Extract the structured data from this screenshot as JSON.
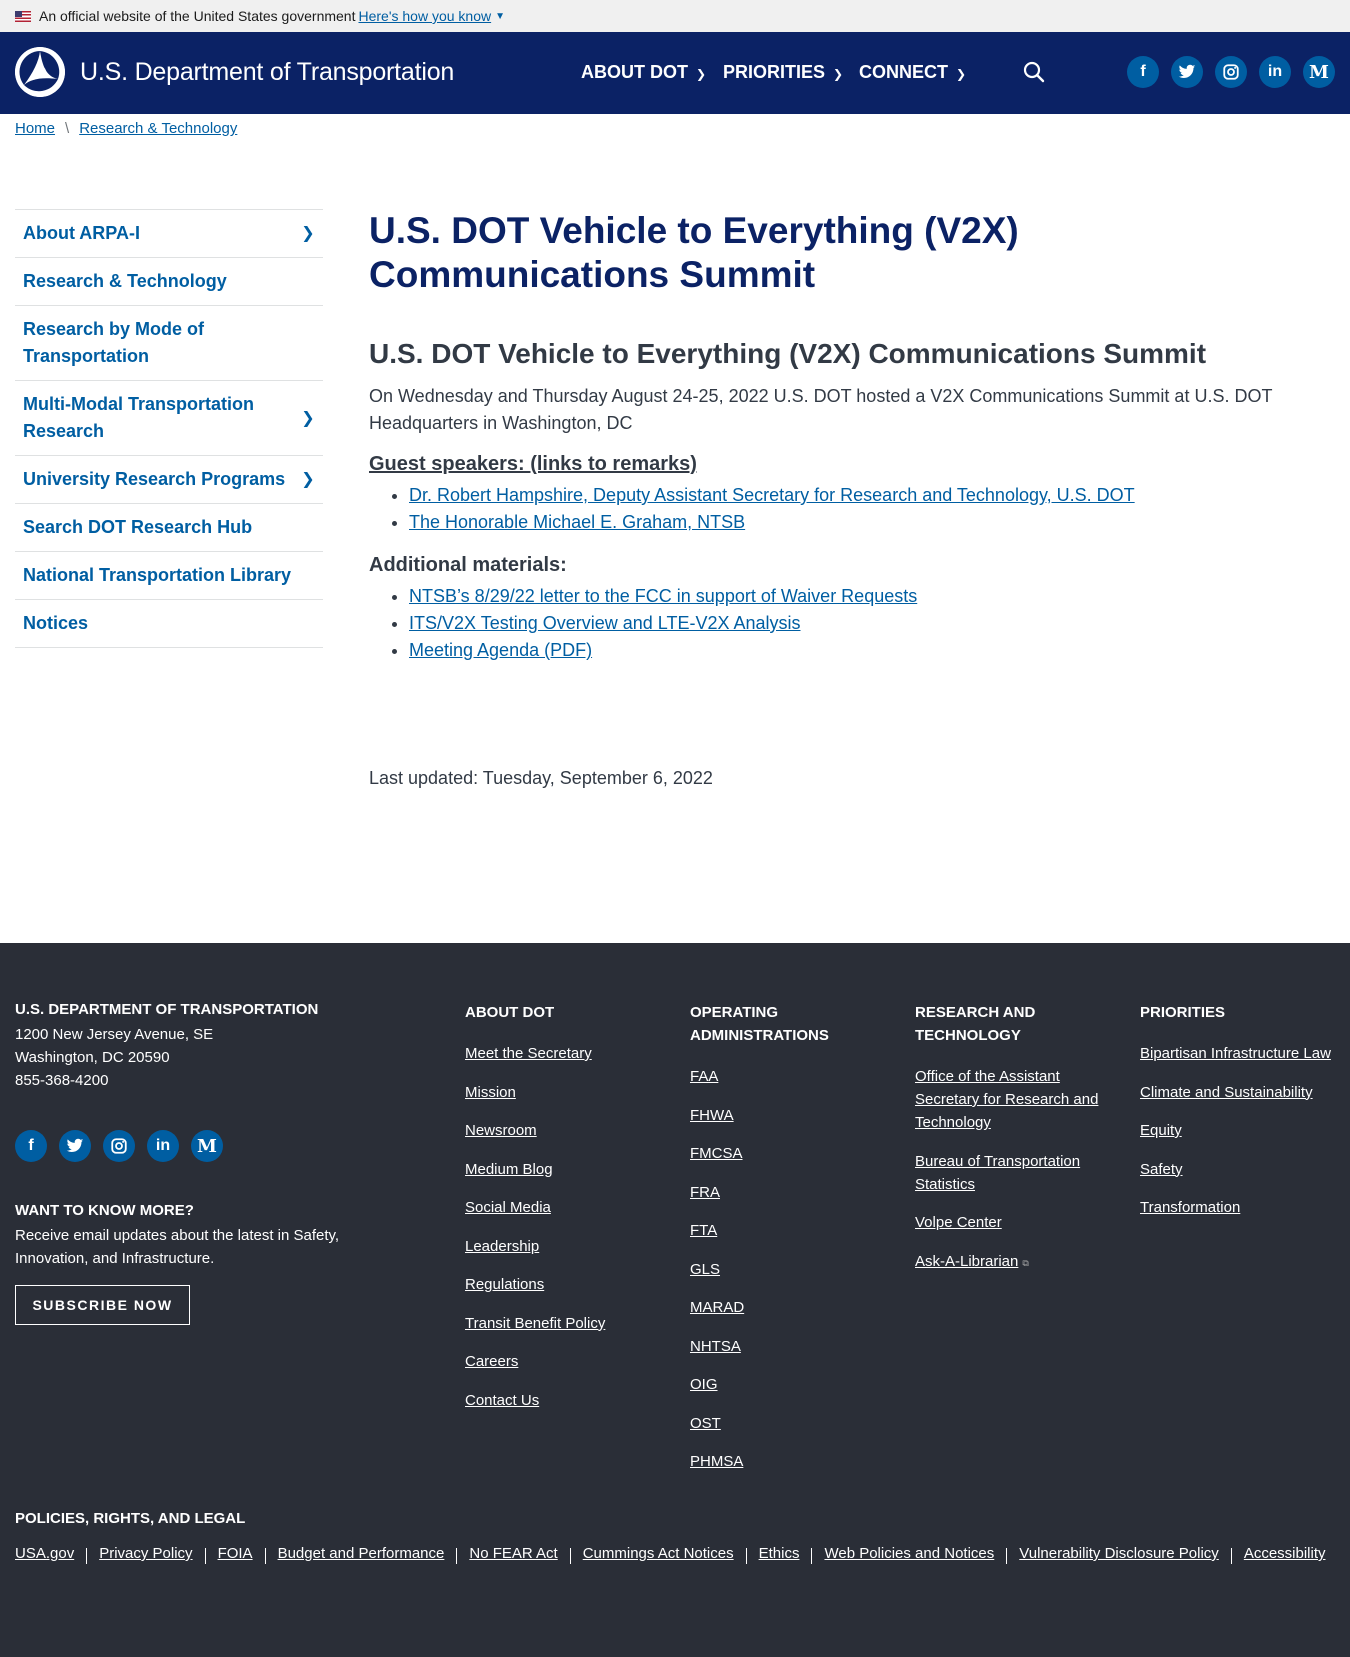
{
  "gov_banner": {
    "official": "An official website of the United States government",
    "how": "Here's how you know"
  },
  "header": {
    "logo_text": "U.S. Department of Transportation",
    "nav": [
      {
        "label": "ABOUT DOT"
      },
      {
        "label": "PRIORITIES"
      },
      {
        "label": "CONNECT"
      }
    ]
  },
  "breadcrumb": {
    "items": [
      "Home",
      "Research & Technology"
    ],
    "separator": "\\"
  },
  "sidebar": {
    "items": [
      {
        "label": "About ARPA-I",
        "has_children": true
      },
      {
        "label": "Research & Technology",
        "has_children": false
      },
      {
        "label": "Research by Mode of Transportation",
        "has_children": false
      },
      {
        "label": "Multi-Modal Transportation Research",
        "has_children": true
      },
      {
        "label": "University Research Programs",
        "has_children": true
      },
      {
        "label": "Search DOT Research Hub",
        "has_children": false
      },
      {
        "label": "National Transportation Library",
        "has_children": false
      },
      {
        "label": "Notices",
        "has_children": false
      }
    ]
  },
  "main": {
    "title": "U.S. DOT Vehicle to Everything (V2X) Communications Summit",
    "subtitle": "U.S. DOT Vehicle to Everything (V2X) Communications Summit",
    "intro": "On Wednesday and Thursday  August 24-25, 2022 U.S. DOT hosted a  V2X Communications Summit at U.S. DOT Headquarters in Washington, DC",
    "guest_heading": "Guest speakers: (links to remarks)",
    "guests": [
      "Dr. Robert Hampshire, Deputy Assistant Secretary for Research and Technology, U.S. DOT",
      "The Honorable Michael E. Graham, NTSB"
    ],
    "materials_heading": "Additional materials:",
    "materials": [
      "NTSB’s 8/29/22 letter to the FCC in support of Waiver Requests",
      "ITS/V2X Testing Overview and LTE-V2X Analysis",
      "Meeting Agenda (PDF)"
    ],
    "last_updated": "Last updated: Tuesday, September 6, 2022"
  },
  "social": [
    {
      "name": "facebook-icon",
      "glyph": "f"
    },
    {
      "name": "twitter-icon",
      "glyph": "🐦"
    },
    {
      "name": "instagram-icon",
      "glyph": "◎"
    },
    {
      "name": "linkedin-icon",
      "glyph": "in"
    },
    {
      "name": "medium-icon",
      "glyph": "M"
    }
  ],
  "footer": {
    "org": "U.S. DEPARTMENT OF TRANSPORTATION",
    "address1": "1200 New Jersey Avenue, SE",
    "address2": "Washington, DC 20590",
    "phone": "855-368-4200",
    "know_heading": "WANT TO KNOW MORE?",
    "know_text": "Receive email updates about the latest in Safety, Innovation, and Infrastructure.",
    "subscribe": "SUBSCRIBE NOW",
    "about": {
      "heading": "ABOUT DOT",
      "links": [
        "Meet the Secretary",
        "Mission",
        "Newsroom",
        "Medium Blog",
        "Social Media",
        "Leadership",
        "Regulations",
        "Transit Benefit Policy",
        "Careers",
        "Contact Us"
      ]
    },
    "operating": {
      "heading": "OPERATING ADMINISTRATIONS",
      "links": [
        "FAA",
        "FHWA",
        "FMCSA",
        "FRA",
        "FTA",
        "GLS",
        "MARAD",
        "NHTSA",
        "OIG",
        "OST",
        "PHMSA"
      ]
    },
    "research": {
      "heading": "RESEARCH AND TECHNOLOGY",
      "links": [
        "Office of the Assistant Secretary for Research and Technology",
        "Bureau of Transportation Statistics",
        "Volpe Center",
        "Ask-A-Librarian"
      ]
    },
    "priorities": {
      "heading": "PRIORITIES",
      "links": [
        "Bipartisan Infrastructure Law",
        "Climate and Sustainability",
        "Equity",
        "Safety",
        "Transformation"
      ]
    },
    "legal_heading": "POLICIES, RIGHTS, AND LEGAL",
    "legal_links": [
      "USA.gov",
      "Privacy Policy",
      "FOIA",
      "Budget and Performance",
      "No FEAR Act",
      "Cummings Act Notices",
      "Ethics",
      "Web Policies and Notices",
      "Vulnerability Disclosure Policy",
      "Accessibility"
    ]
  },
  "colors": {
    "header_bg": "#0b2265",
    "link": "#005ea2",
    "footer_bg": "#2a2e37",
    "title": "#0b2265"
  }
}
